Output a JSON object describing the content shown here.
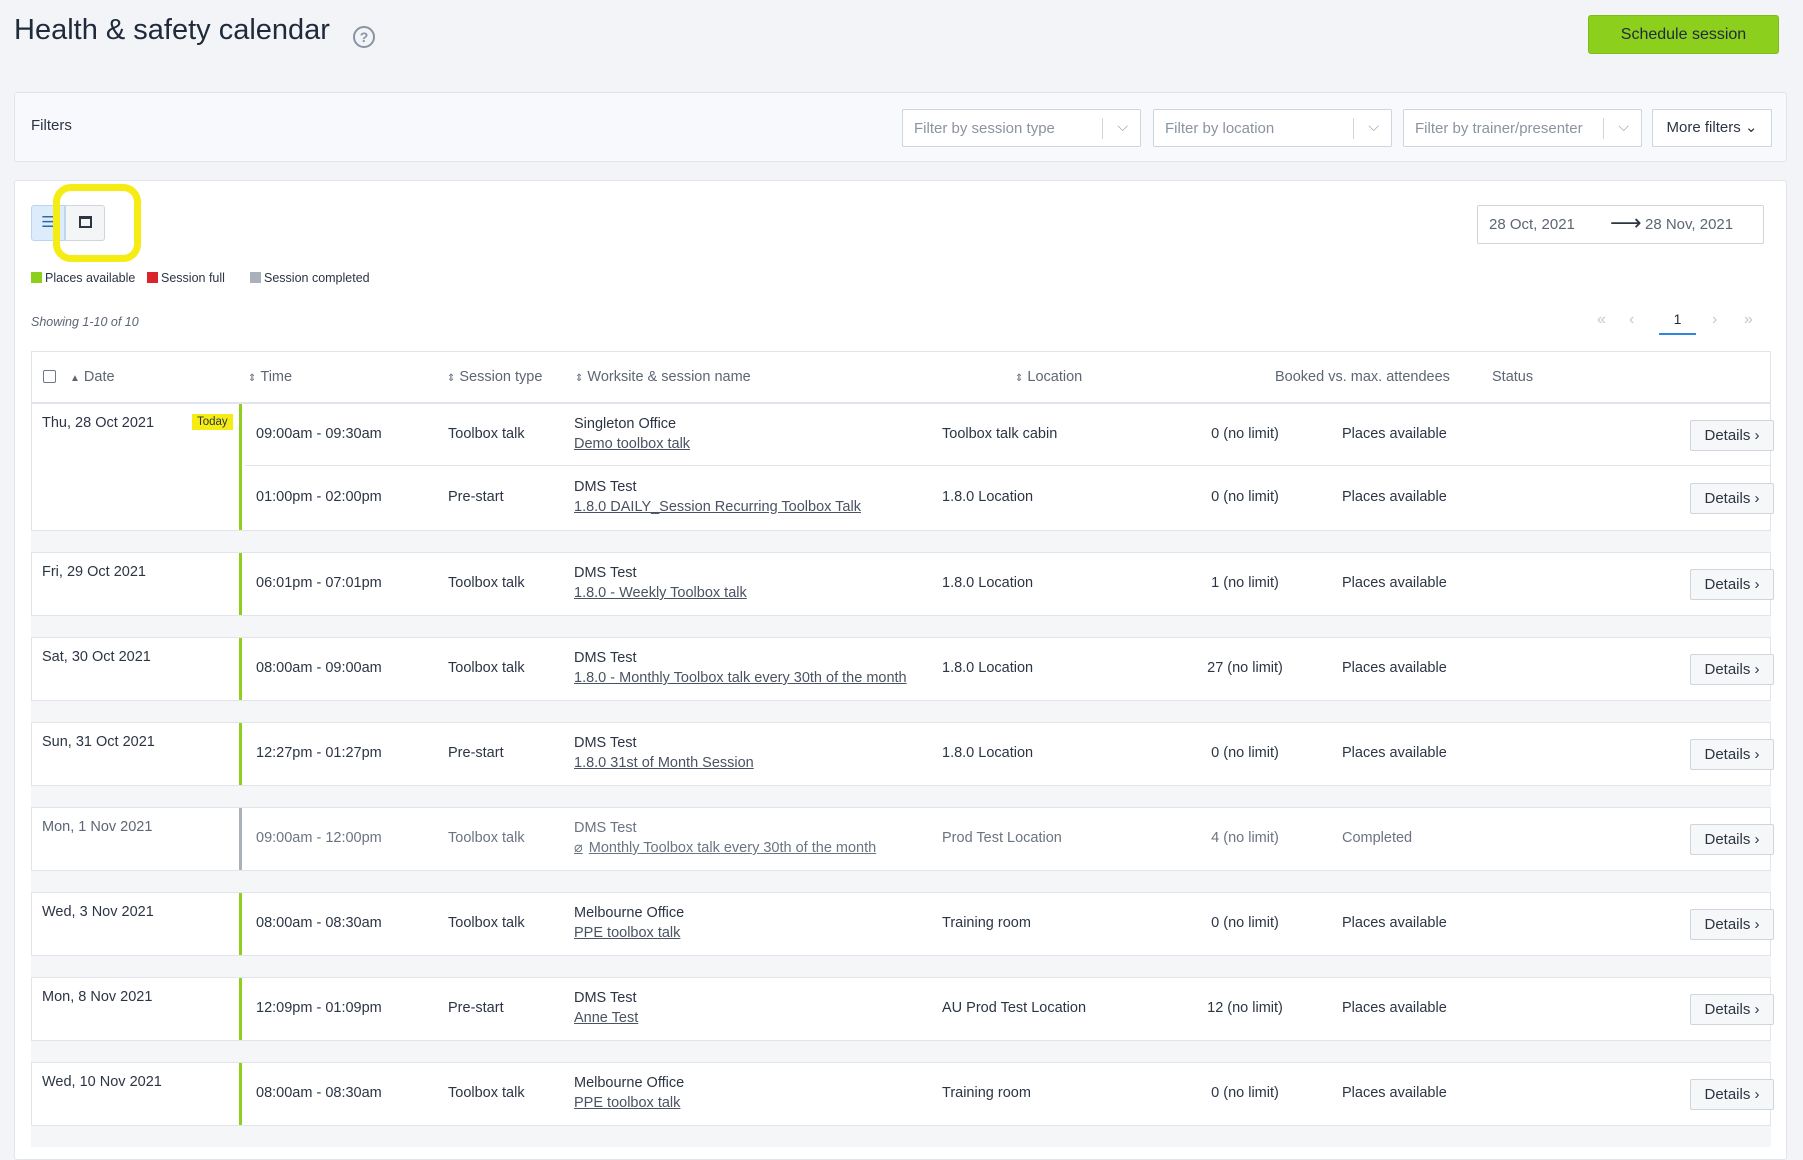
{
  "header": {
    "title": "Health & safety calendar",
    "help_glyph": "?",
    "schedule_label": "Schedule session"
  },
  "filters": {
    "label": "Filters",
    "session_type_placeholder": "Filter by session type",
    "location_placeholder": "Filter by location",
    "trainer_placeholder": "Filter by trainer/presenter",
    "more_label": "More filters ⌄"
  },
  "toolbar": {
    "list_glyph": "☰",
    "date_from": "28 Oct, 2021",
    "date_arrow": "⟶",
    "date_to": "28 Nov, 2021"
  },
  "legend": {
    "available": "Places available",
    "full": "Session full",
    "completed": "Session completed",
    "colors": {
      "available": "#8ccf1c",
      "full": "#d9262e",
      "completed": "#aab1bb"
    }
  },
  "paging": {
    "showing": "Showing 1-10 of 10",
    "first": "«",
    "prev": "‹",
    "current": "1",
    "next": "›",
    "last": "»"
  },
  "columns": {
    "date": "Date",
    "time": "Time",
    "type": "Session type",
    "site": "Worksite & session name",
    "location": "Location",
    "booked": "Booked vs. max. attendees",
    "status": "Status"
  },
  "details_label": "Details ›",
  "today_label": "Today",
  "days": [
    {
      "date": "Thu, 28 Oct 2021",
      "sessions": [
        {
          "time": "09:00am - 09:30am",
          "type": "Toolbox talk",
          "site": "Singleton Office",
          "name": "Demo toolbox talk",
          "location": "Toolbox talk cabin",
          "booked": "0 (no limit)",
          "status": "Places available"
        },
        {
          "time": "01:00pm - 02:00pm",
          "type": "Pre-start",
          "site": "DMS Test",
          "name": "1.8.0 DAILY_Session Recurring Toolbox Talk",
          "location": "1.8.0 Location",
          "booked": "0 (no limit)",
          "status": "Places available"
        }
      ]
    },
    {
      "date": "Fri, 29 Oct 2021",
      "sessions": [
        {
          "time": "06:01pm - 07:01pm",
          "type": "Toolbox talk",
          "site": "DMS Test",
          "name": "1.8.0 - Weekly Toolbox talk",
          "location": "1.8.0 Location",
          "booked": "1 (no limit)",
          "status": "Places available"
        }
      ]
    },
    {
      "date": "Sat, 30 Oct 2021",
      "sessions": [
        {
          "time": "08:00am - 09:00am",
          "type": "Toolbox talk",
          "site": "DMS Test",
          "name": "1.8.0 - Monthly Toolbox talk every 30th of the month",
          "location": "1.8.0 Location",
          "booked": "27 (no limit)",
          "status": "Places available"
        }
      ]
    },
    {
      "date": "Sun, 31 Oct 2021",
      "sessions": [
        {
          "time": "12:27pm - 01:27pm",
          "type": "Pre-start",
          "site": "DMS Test",
          "name": "1.8.0 31st of Month Session",
          "location": "1.8.0 Location",
          "booked": "0 (no limit)",
          "status": "Places available"
        }
      ]
    },
    {
      "date": "Mon, 1 Nov 2021",
      "sessions": [
        {
          "time": "09:00am - 12:00pm",
          "type": "Toolbox talk",
          "site": "DMS Test",
          "name": "Monthly Toolbox talk every 30th of the month",
          "location": "Prod Test Location",
          "booked": "4 (no limit)",
          "status": "Completed"
        }
      ]
    },
    {
      "date": "Wed, 3 Nov 2021",
      "sessions": [
        {
          "time": "08:00am - 08:30am",
          "type": "Toolbox talk",
          "site": "Melbourne Office",
          "name": "PPE toolbox talk",
          "location": "Training room",
          "booked": "0 (no limit)",
          "status": "Places available"
        }
      ]
    },
    {
      "date": "Mon, 8 Nov 2021",
      "sessions": [
        {
          "time": "12:09pm - 01:09pm",
          "type": "Pre-start",
          "site": "DMS Test",
          "name": "Anne Test",
          "location": "AU Prod Test Location",
          "booked": "12 (no limit)",
          "status": "Places available"
        }
      ]
    },
    {
      "date": "Wed, 10 Nov 2021",
      "sessions": [
        {
          "time": "08:00am - 08:30am",
          "type": "Toolbox talk",
          "site": "Melbourne Office",
          "name": "PPE toolbox talk",
          "location": "Training room",
          "booked": "0 (no limit)",
          "status": "Places available"
        }
      ]
    }
  ]
}
